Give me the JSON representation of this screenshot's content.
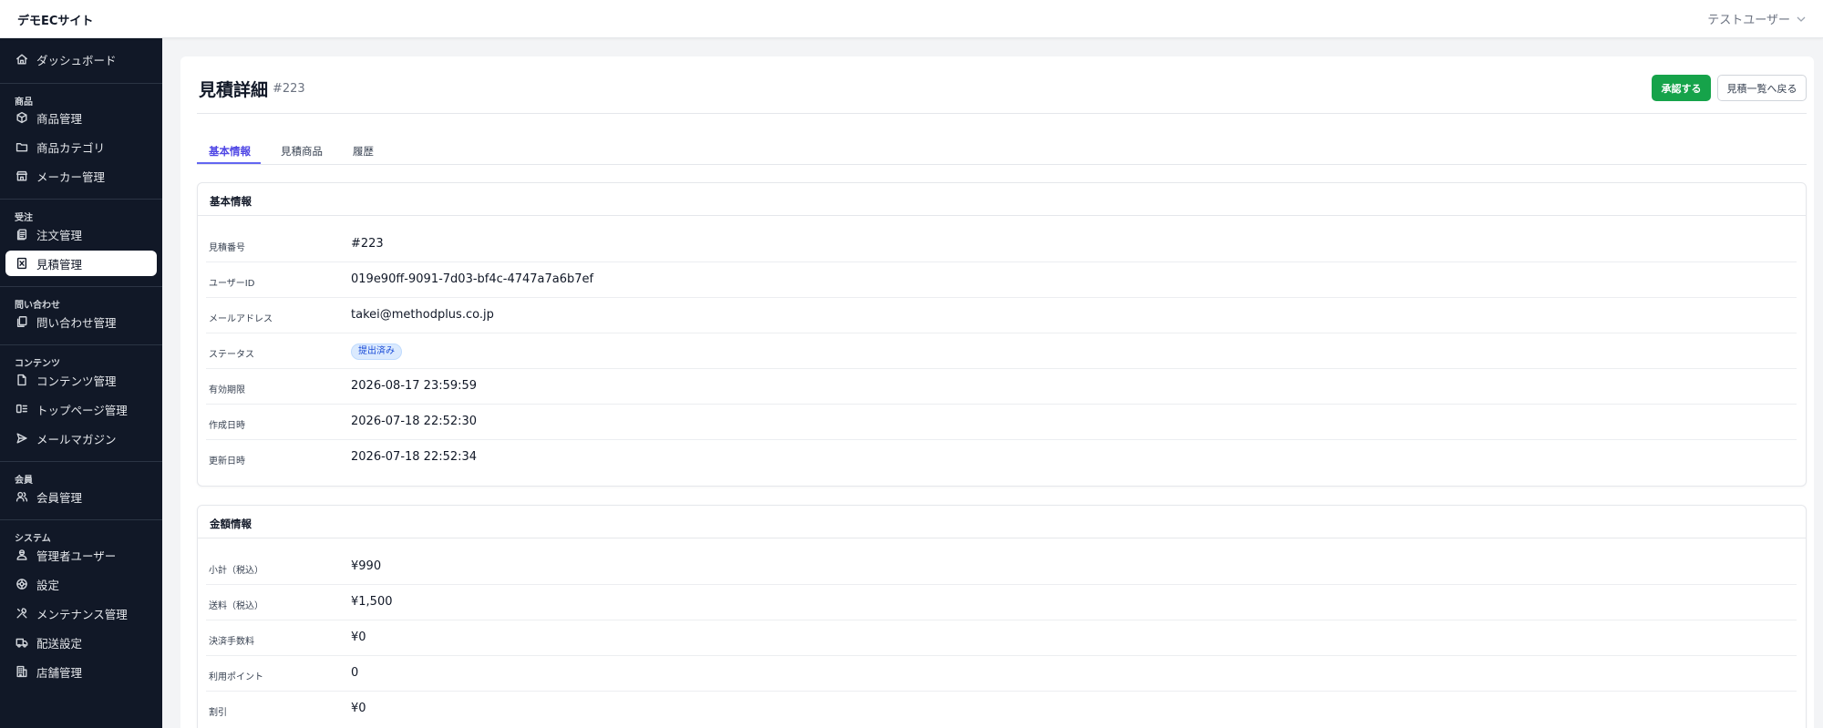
{
  "app": {
    "brand": "デモECサイト",
    "user_name": "テストユーザー"
  },
  "sidebar": {
    "dashboard": "ダッシュボード",
    "groups": {
      "products": "商品",
      "orders": "受注",
      "inquiries": "問い合わせ",
      "contents": "コンテンツ",
      "members": "会員",
      "system": "システム"
    },
    "items": {
      "product_manage": "商品管理",
      "product_category": "商品カテゴリ",
      "maker_manage": "メーカー管理",
      "order_manage": "注文管理",
      "estimate_manage": "見積管理",
      "inquiry_manage": "問い合わせ管理",
      "content_manage": "コンテンツ管理",
      "toppage_manage": "トップページ管理",
      "mail_magazine": "メールマガジン",
      "member_manage": "会員管理",
      "admin_users": "管理者ユーザー",
      "settings": "設定",
      "maintenance": "メンテナンス管理",
      "shipping_settings": "配送設定",
      "store_manage": "店舗管理"
    }
  },
  "page": {
    "title": "見積詳細",
    "id": "#223",
    "approve_label": "承認する",
    "back_label": "見積一覧へ戻る"
  },
  "tabs": {
    "basic": "基本情報",
    "items": "見積商品",
    "history": "履歴"
  },
  "basic_info": {
    "title": "基本情報",
    "rows": [
      {
        "label": "見積番号",
        "value": "#223"
      },
      {
        "label": "ユーザーID",
        "value": "019e90ff-9091-7d03-bf4c-4747a7a6b7ef"
      },
      {
        "label": "メールアドレス",
        "value": "takei@methodplus.co.jp"
      },
      {
        "label": "ステータス",
        "value": "提出済み"
      },
      {
        "label": "有効期限",
        "value": "2026-08-17 23:59:59"
      },
      {
        "label": "作成日時",
        "value": "2026-07-18 22:52:30"
      },
      {
        "label": "更新日時",
        "value": "2026-07-18 22:52:34"
      }
    ]
  },
  "amount_info": {
    "title": "金額情報",
    "rows": [
      {
        "label": "小計（税込）",
        "value": "¥990"
      },
      {
        "label": "送料（税込）",
        "value": "¥1,500"
      },
      {
        "label": "決済手数料",
        "value": "¥0"
      },
      {
        "label": "利用ポイント",
        "value": "0"
      },
      {
        "label": "割引",
        "value": "¥0"
      }
    ]
  },
  "colors": {
    "sidebar_bg": "#111827",
    "approve_green": "#16a34a",
    "tab_active": "#4f46e5",
    "badge_bg": "#dbeafe"
  }
}
